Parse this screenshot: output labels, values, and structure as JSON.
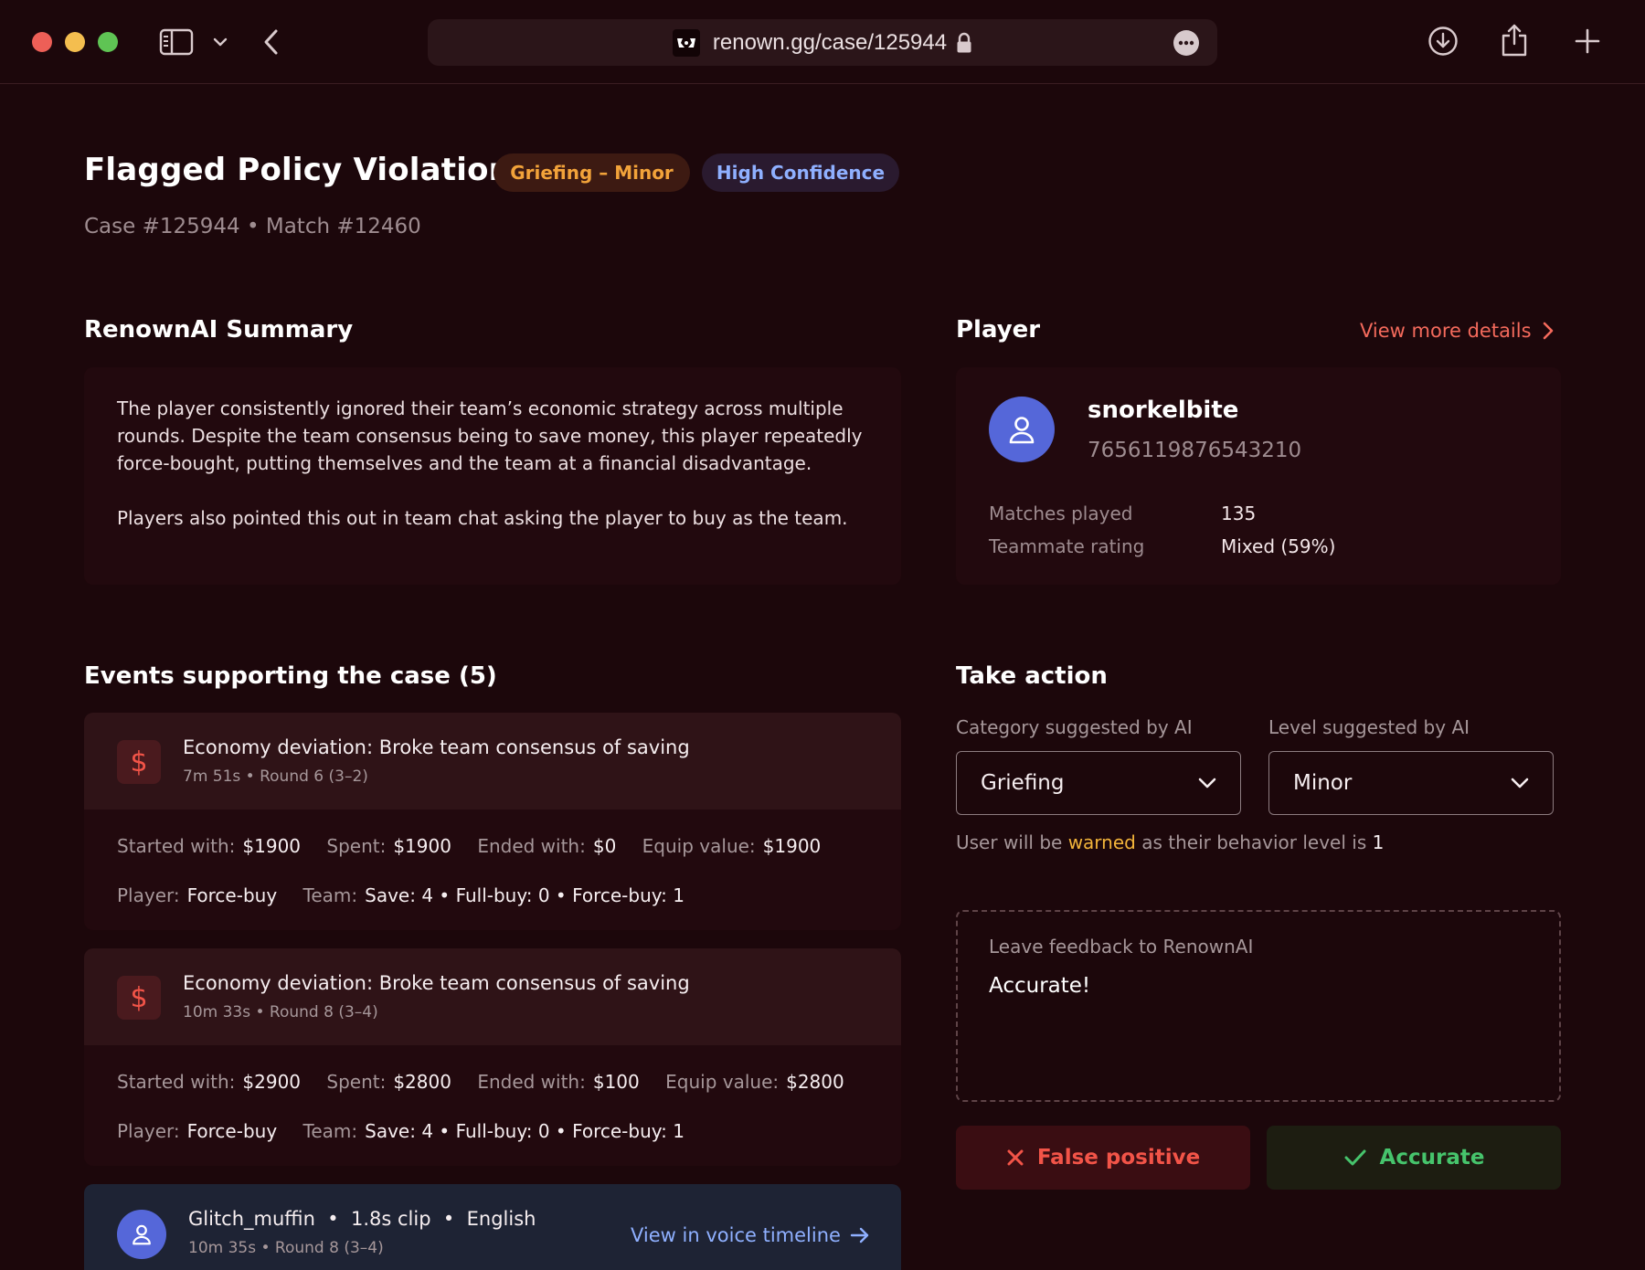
{
  "browser": {
    "url": "renown.gg/case/125944"
  },
  "header": {
    "title": "Flagged Policy Violation",
    "severity_badge": "Griefing – Minor",
    "confidence_badge": "High Confidence",
    "subtitle": "Case #125944 • Match #12460"
  },
  "summary": {
    "heading": "RenownAI Summary",
    "paragraph_1": "The player consistently ignored their team’s economic strategy across multiple rounds. Despite the team consensus being to save money, this player repeatedly force-bought, putting themselves and the team at a financial disadvantage.",
    "paragraph_2": "Players also pointed this out in team chat asking the player to buy as the team."
  },
  "player": {
    "heading": "Player",
    "view_more": "View more details",
    "name": "snorkelbite",
    "id": "7656119876543210",
    "stats": [
      {
        "label": "Matches played",
        "value": "135"
      },
      {
        "label": "Teammate rating",
        "value": "Mixed (59%)"
      }
    ]
  },
  "events": {
    "heading": "Events supporting the case (5)",
    "items": [
      {
        "icon": "dollar-icon",
        "title": "Economy deviation: Broke team consensus of saving",
        "meta": "7m 51s • Round 6 (3–2)",
        "started_label": "Started with:",
        "started": "$1900",
        "spent_label": "Spent:",
        "spent": "$1900",
        "ended_label": "Ended with:",
        "ended": "$0",
        "equip_label": "Equip value:",
        "equip": "$1900",
        "player_label": "Player:",
        "player": "Force-buy",
        "team_label": "Team:",
        "team": "Save: 4 • Full-buy: 0 • Force-buy: 1"
      },
      {
        "icon": "dollar-icon",
        "title": "Economy deviation: Broke team consensus of saving",
        "meta": "10m 33s • Round 8 (3–4)",
        "started_label": "Started with:",
        "started": "$2900",
        "spent_label": "Spent:",
        "spent": "$2800",
        "ended_label": "Ended with:",
        "ended": "$100",
        "equip_label": "Equip value:",
        "equip": "$2800",
        "player_label": "Player:",
        "player": "Force-buy",
        "team_label": "Team:",
        "team": "Save: 4 • Full-buy: 0 • Force-buy: 1"
      }
    ],
    "voice": {
      "title": "Glitch_muffin  •  1.8s clip  •  English",
      "meta": "10m 35s • Round 8 (3–4)",
      "link": "View in voice timeline"
    }
  },
  "action": {
    "heading": "Take action",
    "category_label": "Category suggested by AI",
    "category_value": "Griefing",
    "level_label": "Level suggested by AI",
    "level_value": "Minor",
    "warn_prefix": "User will be",
    "warn_word": "warned",
    "warn_middle": "as their behavior level is",
    "warn_level": "1",
    "feedback_label": "Leave feedback to RenownAI",
    "feedback_value": "Accurate!",
    "false_positive_label": "False positive",
    "accurate_label": "Accurate"
  },
  "colors": {
    "background": "#1c070b",
    "accent_red": "#f25448",
    "accent_orange": "#f2a33a",
    "accent_blue": "#8fb0ff",
    "accent_green": "#46c46c"
  }
}
